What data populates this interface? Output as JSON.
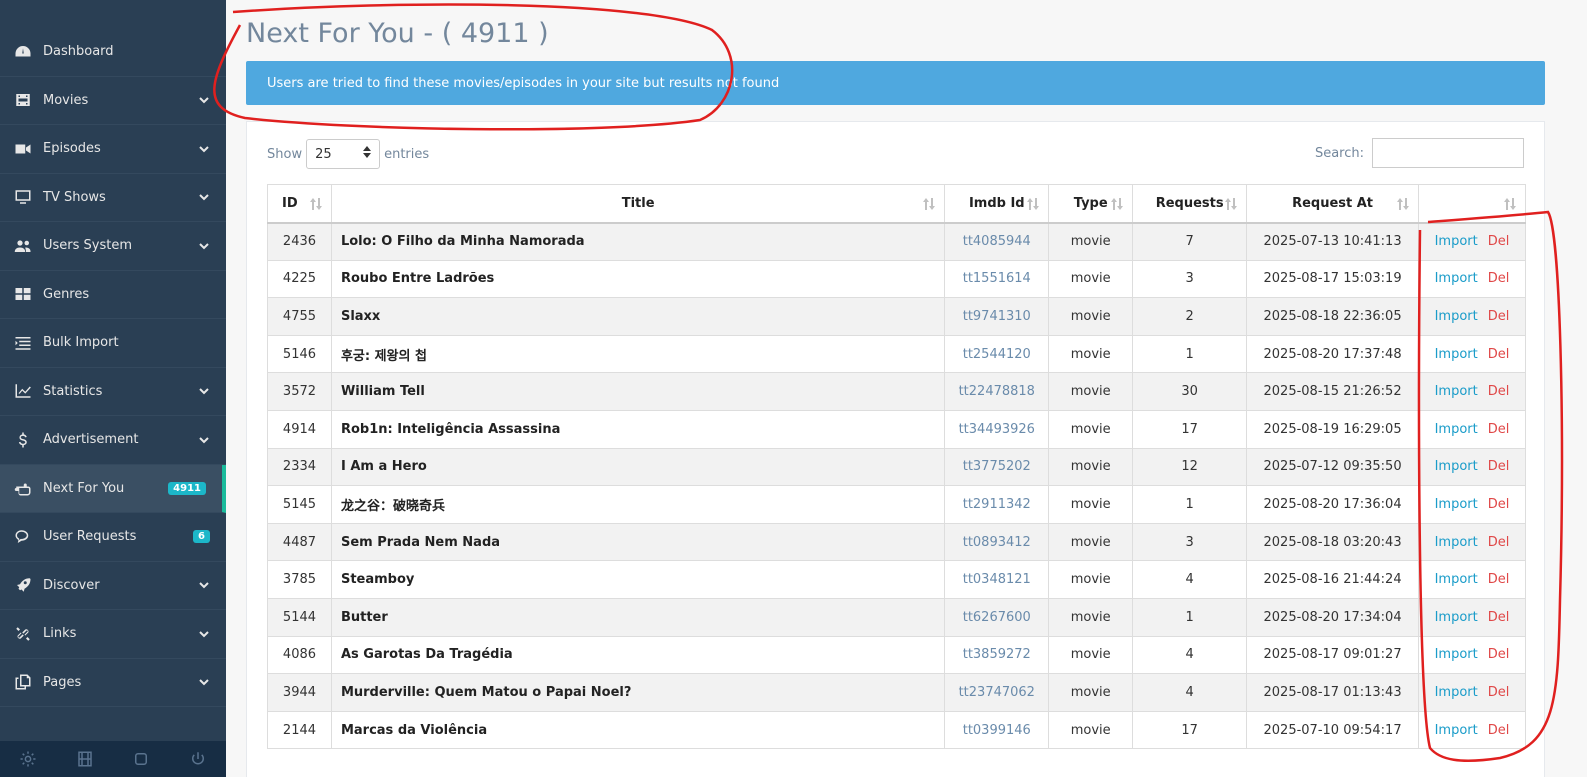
{
  "sidebar": {
    "items": [
      {
        "label": "Dashboard",
        "icon": "dashboard-icon",
        "chevron": false
      },
      {
        "label": "Movies",
        "icon": "film-icon",
        "chevron": true
      },
      {
        "label": "Episodes",
        "icon": "video-camera-icon",
        "chevron": true
      },
      {
        "label": "TV Shows",
        "icon": "monitor-icon",
        "chevron": true
      },
      {
        "label": "Users System",
        "icon": "users-icon",
        "chevron": true
      },
      {
        "label": "Genres",
        "icon": "grid-icon",
        "chevron": false
      },
      {
        "label": "Bulk Import",
        "icon": "list-icon",
        "chevron": false
      },
      {
        "label": "Statistics",
        "icon": "line-chart-icon",
        "chevron": true
      },
      {
        "label": "Advertisement",
        "icon": "dollar-icon",
        "chevron": true
      },
      {
        "label": "Next For You",
        "icon": "hand-pointer-icon",
        "chevron": false,
        "badge": "4911",
        "active": true
      },
      {
        "label": "User Requests",
        "icon": "chat-icon",
        "chevron": false,
        "badge": "6"
      },
      {
        "label": "Discover",
        "icon": "rocket-icon",
        "chevron": true
      },
      {
        "label": "Links",
        "icon": "unlink-icon",
        "chevron": true
      },
      {
        "label": "Pages",
        "icon": "copy-icon",
        "chevron": true
      }
    ],
    "footer_icons": [
      "gear-icon",
      "film-icon",
      "square-icon",
      "power-icon"
    ]
  },
  "page": {
    "title": "Next For You - ( 4911 )",
    "banner": "Users are tried to find these movies/episodes in your site but results not found"
  },
  "controls": {
    "show_label": "Show",
    "entries_value": "25",
    "entries_label": "entries",
    "search_label": "Search:",
    "search_value": ""
  },
  "table": {
    "headers": [
      "ID",
      "Title",
      "Imdb Id",
      "Type",
      "Requests",
      "Request At",
      ""
    ],
    "rows": [
      {
        "id": "2436",
        "title": "Lolo: O Filho da Minha Namorada",
        "imdb": "tt4085944",
        "type": "movie",
        "requests": "7",
        "at": "2025-07-13 10:41:13"
      },
      {
        "id": "4225",
        "title": "Roubo Entre Ladrões",
        "imdb": "tt1551614",
        "type": "movie",
        "requests": "3",
        "at": "2025-08-17 15:03:19"
      },
      {
        "id": "4755",
        "title": "Slaxx",
        "imdb": "tt9741310",
        "type": "movie",
        "requests": "2",
        "at": "2025-08-18 22:36:05"
      },
      {
        "id": "5146",
        "title": "후궁: 제왕의 첩",
        "imdb": "tt2544120",
        "type": "movie",
        "requests": "1",
        "at": "2025-08-20 17:37:48"
      },
      {
        "id": "3572",
        "title": "William Tell",
        "imdb": "tt22478818",
        "type": "movie",
        "requests": "30",
        "at": "2025-08-15 21:26:52"
      },
      {
        "id": "4914",
        "title": "Rob1n: Inteligência Assassina",
        "imdb": "tt34493926",
        "type": "movie",
        "requests": "17",
        "at": "2025-08-19 16:29:05"
      },
      {
        "id": "2334",
        "title": "I Am a Hero",
        "imdb": "tt3775202",
        "type": "movie",
        "requests": "12",
        "at": "2025-07-12 09:35:50"
      },
      {
        "id": "5145",
        "title": "龙之谷：破晓奇兵",
        "imdb": "tt2911342",
        "type": "movie",
        "requests": "1",
        "at": "2025-08-20 17:36:04"
      },
      {
        "id": "4487",
        "title": "Sem Prada Nem Nada",
        "imdb": "tt0893412",
        "type": "movie",
        "requests": "3",
        "at": "2025-08-18 03:20:43"
      },
      {
        "id": "3785",
        "title": "Steamboy",
        "imdb": "tt0348121",
        "type": "movie",
        "requests": "4",
        "at": "2025-08-16 21:44:24"
      },
      {
        "id": "5144",
        "title": "Butter",
        "imdb": "tt6267600",
        "type": "movie",
        "requests": "1",
        "at": "2025-08-20 17:34:04"
      },
      {
        "id": "4086",
        "title": "As Garotas Da Tragédia",
        "imdb": "tt3859272",
        "type": "movie",
        "requests": "4",
        "at": "2025-08-17 09:01:27"
      },
      {
        "id": "3944",
        "title": "Murderville: Quem Matou o Papai Noel?",
        "imdb": "tt23747062",
        "type": "movie",
        "requests": "4",
        "at": "2025-08-17 01:13:43"
      },
      {
        "id": "2144",
        "title": "Marcas da Violência",
        "imdb": "tt0399146",
        "type": "movie",
        "requests": "17",
        "at": "2025-07-10 09:54:17"
      }
    ],
    "import_label": "Import",
    "del_label": "Del"
  },
  "colors": {
    "sidebar_bg": "#2a3f54",
    "banner_bg": "#4fa8df",
    "badge": "#1cb7c9",
    "active_marker": "#1abb9c",
    "import_link": "#1a9cc9",
    "del_link": "#e04848",
    "annotation": "#e0201f"
  }
}
